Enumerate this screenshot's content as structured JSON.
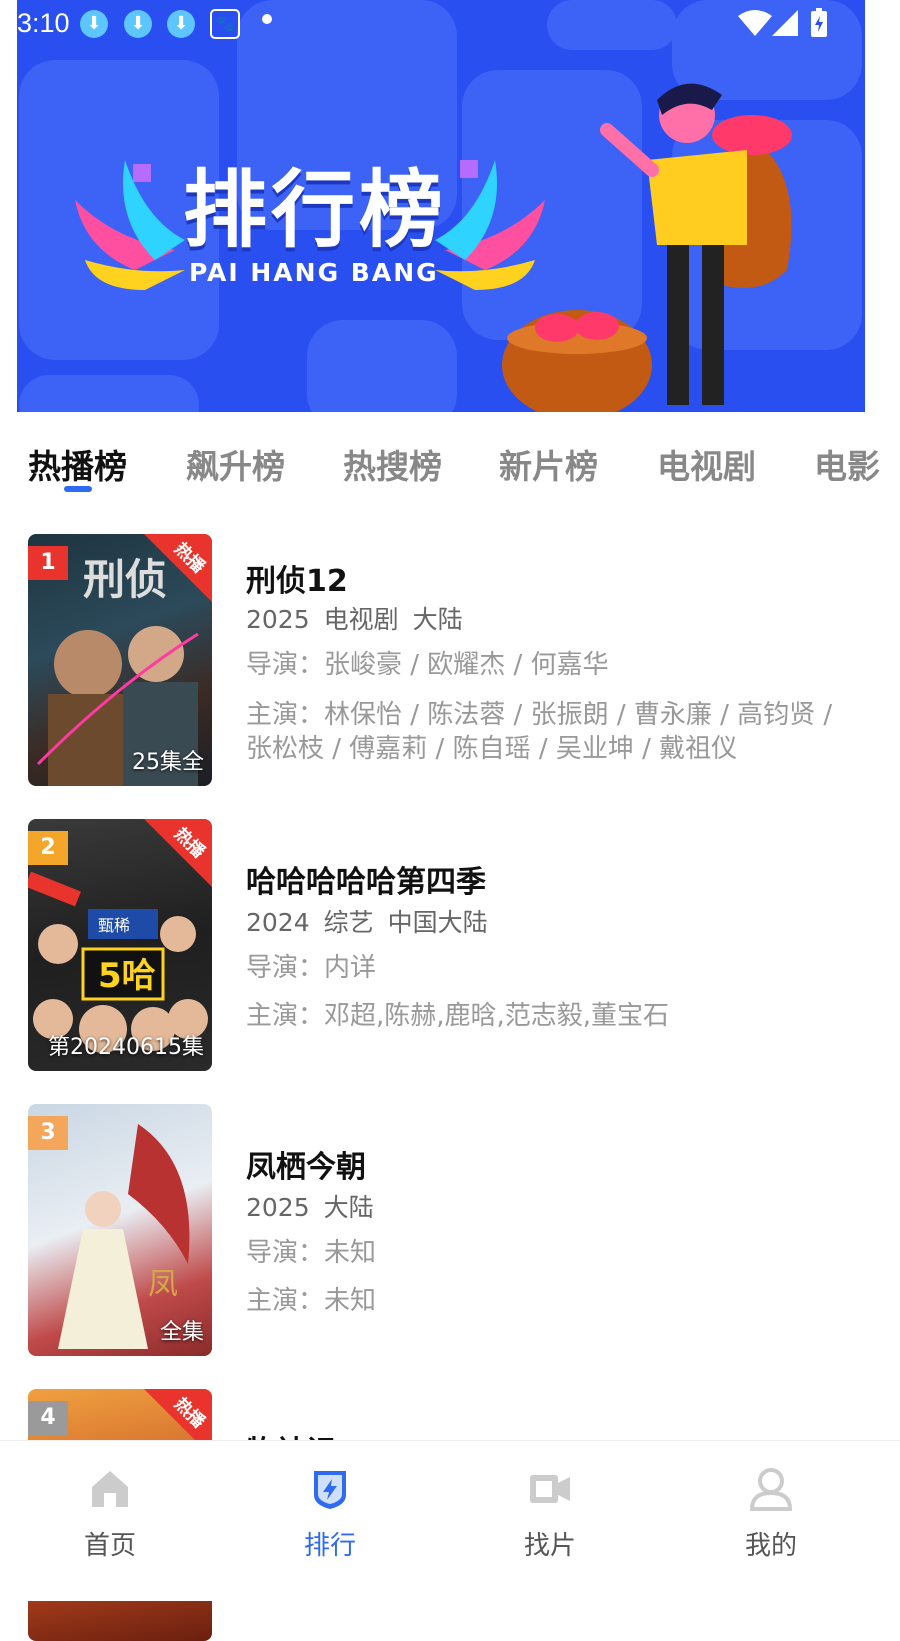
{
  "status_bar": {
    "time": "3:10",
    "icons": [
      "download-icon",
      "download-icon",
      "download-icon",
      "baidu-icon",
      "dot-icon",
      "wifi-icon",
      "signal-icon",
      "battery-charging-icon"
    ]
  },
  "banner": {
    "title_zh": "排行榜",
    "title_en": "PAI HANG BANG"
  },
  "tabs": [
    {
      "label": "热播榜",
      "active": true
    },
    {
      "label": "飙升榜",
      "active": false
    },
    {
      "label": "热搜榜",
      "active": false
    },
    {
      "label": "新片榜",
      "active": false
    },
    {
      "label": "电视剧",
      "active": false
    },
    {
      "label": "电影",
      "active": false
    }
  ],
  "items": [
    {
      "rank": "1",
      "rank_color": "#e8342c",
      "hot_badge": "热播",
      "poster_note": "25集全",
      "title": "刑侦12",
      "year": "2025",
      "genre": "电视剧",
      "region": "大陆",
      "director": "导演：张峻豪 / 欧耀杰 / 何嘉华",
      "cast": "主演：林保怡 / 陈法蓉 / 张振朗 / 曹永廉 / 高钧贤 / 张松枝 / 傅嘉莉 / 陈自瑶 / 吴业坤 / 戴祖仪"
    },
    {
      "rank": "2",
      "rank_color": "#f4a62a",
      "hot_badge": "热播",
      "poster_note": "第20240615集",
      "title": "哈哈哈哈哈第四季",
      "year": "2024",
      "genre": "综艺",
      "region": "中国大陆",
      "director": "导演：内详",
      "cast": "主演：邓超,陈赫,鹿晗,范志毅,董宝石"
    },
    {
      "rank": "3",
      "rank_color": "#f4a65a",
      "hot_badge": "",
      "poster_note": "全集",
      "title": "凤栖今朝",
      "year": "2025",
      "genre": "",
      "region": "大陆",
      "director": "导演：未知",
      "cast": "主演：未知"
    },
    {
      "rank": "4",
      "rank_color": "#9a9a9a",
      "hot_badge": "热播",
      "poster_note": "",
      "title": "牧神记",
      "year": "",
      "genre": "",
      "region": "",
      "director": "",
      "cast": ""
    }
  ],
  "bottom_nav": [
    {
      "label": "首页",
      "icon": "home-icon",
      "active": false
    },
    {
      "label": "排行",
      "icon": "ranking-icon",
      "active": true
    },
    {
      "label": "找片",
      "icon": "video-camera-icon",
      "active": false
    },
    {
      "label": "我的",
      "icon": "user-icon",
      "active": false
    }
  ],
  "colors": {
    "accent": "#2f6bf2",
    "banner_bg": "#2a4ff0",
    "hot_ribbon": "#e8342c"
  }
}
